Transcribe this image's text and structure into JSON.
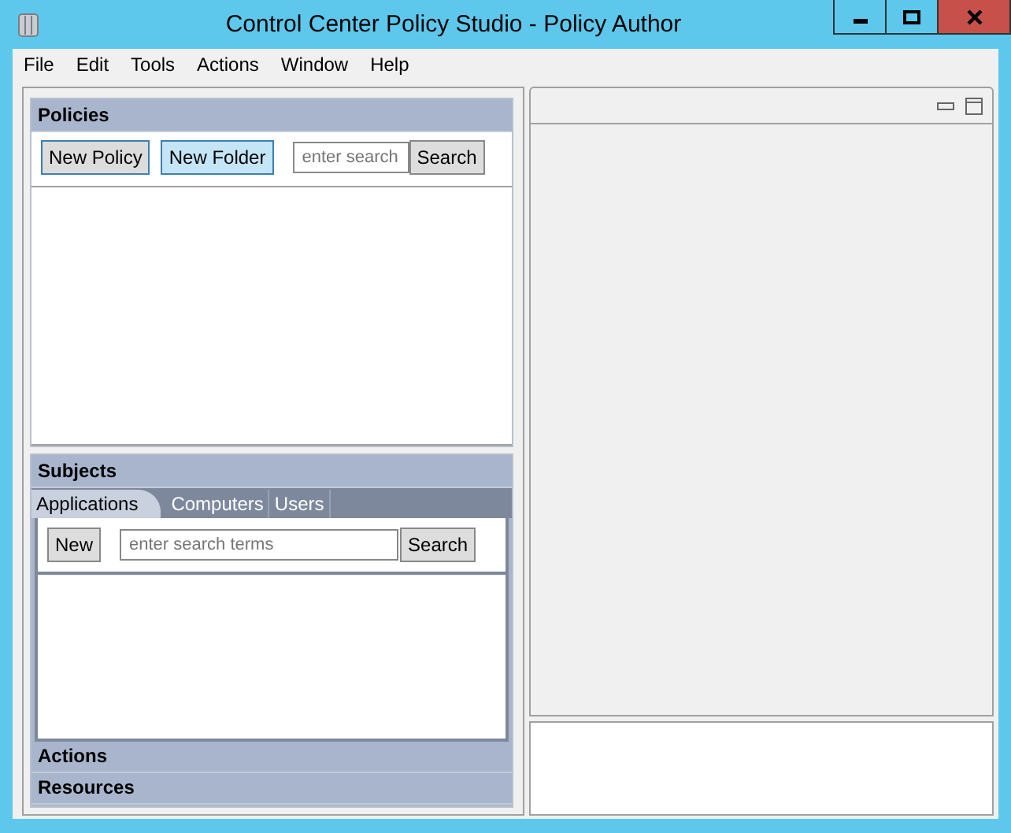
{
  "window": {
    "title": "Control Center Policy Studio - Policy Author"
  },
  "menu": [
    "File",
    "Edit",
    "Tools",
    "Actions",
    "Window",
    "Help"
  ],
  "policies": {
    "title": "Policies",
    "buttons": [
      {
        "label": "New Policy",
        "kind": "plain"
      },
      {
        "label": "New Folder",
        "kind": "highlighted"
      }
    ],
    "search": {
      "placeholder": "enter search"
    },
    "search_button": "Search"
  },
  "subjects": {
    "title": "Subjects",
    "tabs": [
      {
        "label": "Applications",
        "selected": true
      },
      {
        "label": "Computers",
        "selected": false
      },
      {
        "label": "Users",
        "selected": false
      }
    ],
    "new_button": "New",
    "search": {
      "placeholder": "enter search terms"
    },
    "search_button": "Search"
  },
  "sections": [
    "Actions",
    "Resources"
  ]
}
